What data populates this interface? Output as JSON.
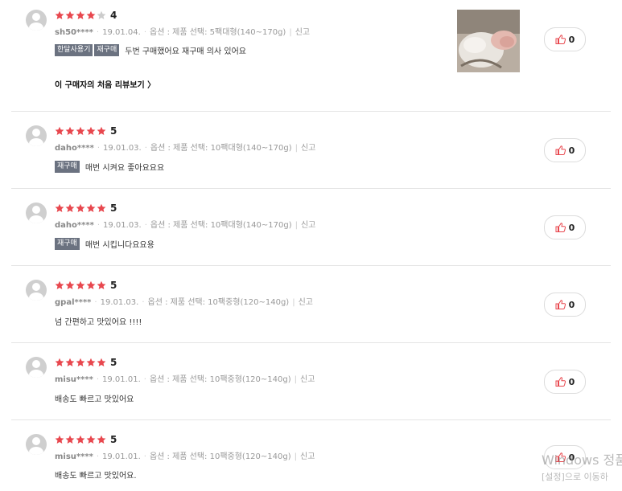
{
  "colors": {
    "star_filled": "#e8474e",
    "star_empty": "#cccccc",
    "tag_bg": "#6b7280",
    "like_icon": "#e8474e"
  },
  "reviews": [
    {
      "stars": 4,
      "rating": "4",
      "user": "sh50****",
      "date": "19.01.04.",
      "option": "옵션 : 제품 선택: 5팩대형(140~170g)",
      "report": "신고",
      "tags": [
        "한달사용기",
        "재구매"
      ],
      "text": "두번 구매했어요 재구매 의사 있어요",
      "first_review_link": "이 구매자의 처음 리뷰보기 〉",
      "has_photo": true,
      "likes": "0"
    },
    {
      "stars": 5,
      "rating": "5",
      "user": "daho****",
      "date": "19.01.03.",
      "option": "옵션 : 제품 선택: 10팩대형(140~170g)",
      "report": "신고",
      "tags": [
        "재구매"
      ],
      "text": "매번 시켜요 좋아요요요",
      "likes": "0"
    },
    {
      "stars": 5,
      "rating": "5",
      "user": "daho****",
      "date": "19.01.03.",
      "option": "옵션 : 제품 선택: 10팩대형(140~170g)",
      "report": "신고",
      "tags": [
        "재구매"
      ],
      "text": "매번 시킵니다요요용",
      "likes": "0"
    },
    {
      "stars": 5,
      "rating": "5",
      "user": "gpal****",
      "date": "19.01.03.",
      "option": "옵션 : 제품 선택: 10팩중형(120~140g)",
      "report": "신고",
      "tags": [],
      "text": "넘 간편하고 맛있어요 !!!!",
      "likes": "0"
    },
    {
      "stars": 5,
      "rating": "5",
      "user": "misu****",
      "date": "19.01.01.",
      "option": "옵션 : 제품 선택: 10팩중형(120~140g)",
      "report": "신고",
      "tags": [],
      "text": "배송도 빠르고 맛있어요",
      "likes": "0"
    },
    {
      "stars": 5,
      "rating": "5",
      "user": "misu****",
      "date": "19.01.01.",
      "option": "옵션 : 제품 선택: 10팩중형(120~140g)",
      "report": "신고",
      "tags": [],
      "text": "배송도 빠르고 맛있어요.",
      "likes": "0"
    }
  ],
  "watermark": {
    "line1": "Windows 정품",
    "line2": "[설정]으로 이동하"
  }
}
